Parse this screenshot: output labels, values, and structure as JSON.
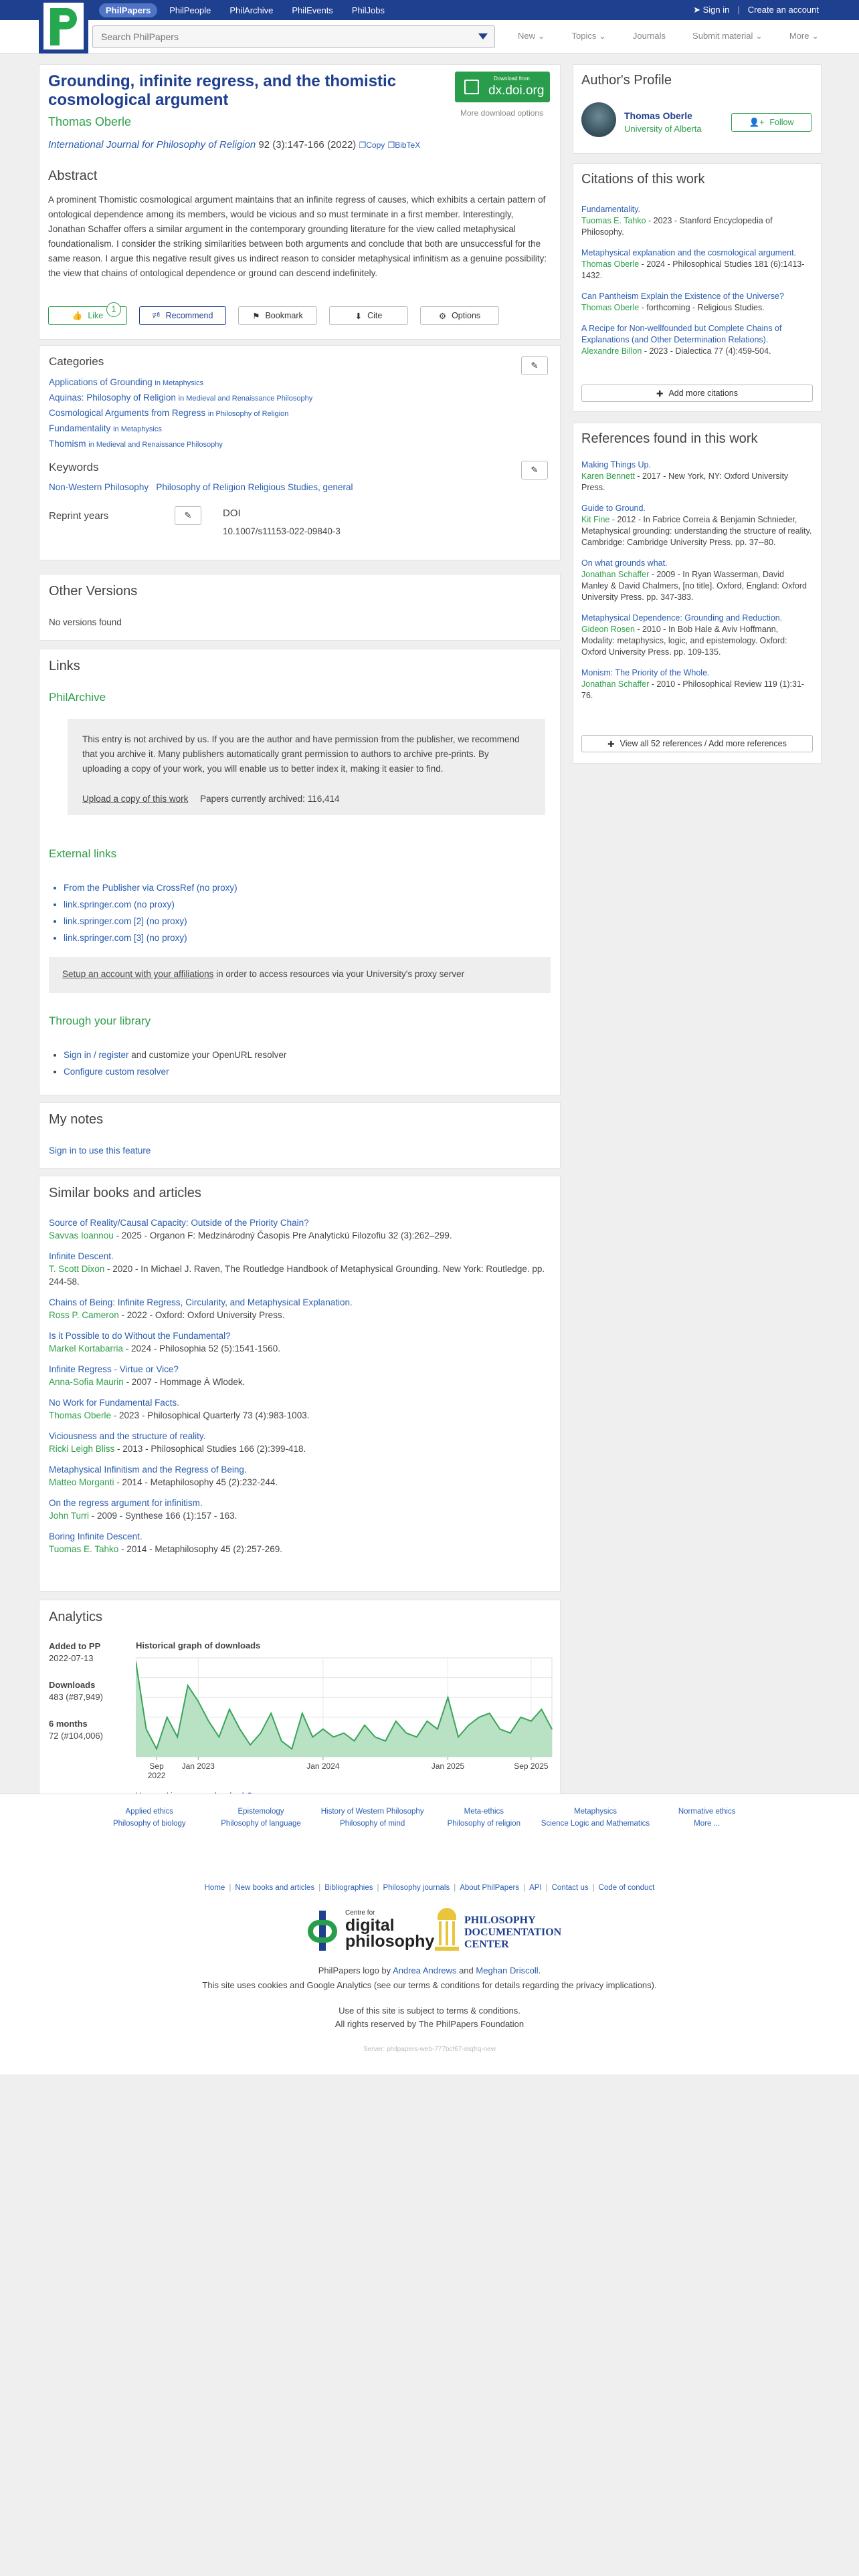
{
  "topnav": {
    "items": [
      "PhilPapers",
      "PhilPeople",
      "PhilArchive",
      "PhilEvents",
      "PhilJobs"
    ],
    "signin": "Sign in",
    "create": "Create an account"
  },
  "search": {
    "placeholder": "Search PhilPapers"
  },
  "subnav": [
    "New",
    "Topics",
    "Journals",
    "Submit material",
    "More"
  ],
  "paper": {
    "title": "Grounding, infinite regress, and the thomistic cosmological argument",
    "author": "Thomas Oberle",
    "journal": "International Journal for Philosophy of Religion",
    "citation": "92 (3):147-166 (2022)",
    "copy": "Copy",
    "bibtex": "BibTeX",
    "download_small": "Download from",
    "download_big": "dx.doi.org",
    "more_options": "More download options",
    "abstract_title": "Abstract",
    "abstract": "A prominent Thomistic cosmological argument maintains that an infinite regress of causes, which exhibits a certain pattern of ontological dependence among its members, would be vicious and so must terminate in a first member. Interestingly, Jonathan Schaffer offers a similar argument in the contemporary grounding literature for the view called metaphysical foundationalism. I consider the striking similarities between both arguments and conclude that both are unsuccessful for the same reason. I argue this negative result gives us indirect reason to consider metaphysical infinitism as a genuine possibility: the view that chains of ontological dependence or ground can descend indefinitely.",
    "buttons": {
      "like": "Like",
      "like_count": "1",
      "recommend": "Recommend",
      "bookmark": "Bookmark",
      "cite": "Cite",
      "options": "Options"
    }
  },
  "categories": {
    "title": "Categories",
    "items": [
      {
        "name": "Applications of Grounding",
        "in": "in Metaphysics"
      },
      {
        "name": "Aquinas: Philosophy of Religion",
        "in": "in Medieval and Renaissance Philosophy"
      },
      {
        "name": "Cosmological Arguments from Regress",
        "in": "in Philosophy of Religion"
      },
      {
        "name": "Fundamentality",
        "in": "in Metaphysics"
      },
      {
        "name": "Thomism",
        "in": "in Medieval and Renaissance Philosophy"
      }
    ],
    "keywords_title": "Keywords",
    "keywords": [
      "Non-Western Philosophy",
      "Philosophy of Religion  Religious Studies, general"
    ],
    "reprint_title": "Reprint years",
    "doi_title": "DOI",
    "doi": "10.1007/s11153-022-09840-3"
  },
  "other_versions": {
    "title": "Other Versions",
    "text": "No versions found"
  },
  "links": {
    "title": "Links",
    "philarchive": "PhilArchive",
    "archive_note": "This entry is not archived by us. If you are the author and have permission from the publisher, we recommend that you archive it. Many publishers automatically grant permission to authors to archive pre-prints. By uploading a copy of your work, you will enable us to better index it, making it easier to find.",
    "upload": "Upload a copy of this work",
    "archived_count": "Papers currently archived: 116,414",
    "external_title": "External links",
    "external": [
      "From the Publisher via CrossRef (no proxy)",
      "link.springer.com (no proxy)",
      "link.springer.com [2] (no proxy)",
      "link.springer.com [3] (no proxy)"
    ],
    "proxy_link": "Setup an account with your affiliations",
    "proxy_text": " in order to access resources via your University's proxy server",
    "library_title": "Through your library",
    "lib_signin": "Sign in / register",
    "lib_text": " and customize your OpenURL resolver",
    "lib_custom": "Configure custom resolver"
  },
  "notes": {
    "title": "My notes",
    "signin": "Sign in to use this feature"
  },
  "similar": {
    "title": "Similar books and articles",
    "items": [
      {
        "t": "Source of Reality/Causal Capacity: Outside of the Priority Chain?",
        "a": "Savvas Ioannou",
        "rest": " - 2025 - Organon F: Medzinárodný Časopis Pre Analytickú Filozofiu 32 (3):262–299."
      },
      {
        "t": "Infinite Descent.",
        "a": "T. Scott Dixon",
        "rest": " - 2020 - In Michael J. Raven, The Routledge Handbook of Metaphysical Grounding. New York: Routledge. pp. 244-58."
      },
      {
        "t": "Chains of Being: Infinite Regress, Circularity, and Metaphysical Explanation.",
        "a": "Ross P. Cameron",
        "rest": " - 2022 - Oxford: Oxford University Press."
      },
      {
        "t": "Is it Possible to do Without the Fundamental?",
        "a": "Markel Kortabarria",
        "rest": " - 2024 - Philosophia 52 (5):1541-1560."
      },
      {
        "t": "Infinite Regress - Virtue or Vice?",
        "a": "Anna-Sofia Maurin",
        "rest": " - 2007 - Hommage À Wlodek."
      },
      {
        "t": "No Work for Fundamental Facts.",
        "a": "Thomas Oberle",
        "rest": " - 2023 - Philosophical Quarterly 73 (4):983-1003."
      },
      {
        "t": "Viciousness and the structure of reality.",
        "a": "Ricki Leigh Bliss",
        "rest": " - 2013 - Philosophical Studies 166 (2):399-418."
      },
      {
        "t": "Metaphysical Infinitism and the Regress of Being.",
        "a": "Matteo Morganti",
        "rest": " - 2014 - Metaphilosophy 45 (2):232-244."
      },
      {
        "t": "On the regress argument for infinitism.",
        "a": "John Turri",
        "rest": " - 2009 - Synthese 166 (1):157 - 163."
      },
      {
        "t": "Boring Infinite Descent.",
        "a": "Tuomas E. Tahko",
        "rest": " - 2014 - Metaphilosophy 45 (2):257-269."
      }
    ]
  },
  "analytics": {
    "title": "Analytics",
    "added_label": "Added to PP",
    "added": "2022-07-13",
    "downloads_label": "Downloads",
    "downloads": "483 (#87,949)",
    "six_label": "6 months",
    "six": "72 (#104,006)",
    "graph_title": "Historical graph of downloads",
    "increase": "How can I increase my downloads?",
    "x_ticks": [
      "Sep 2022",
      "Jan 2023",
      "Jan 2024",
      "Jan 2025",
      "Sep 2025"
    ]
  },
  "chart_data": {
    "type": "area",
    "title": "Historical graph of downloads",
    "x": [
      "Jul 2022",
      "Aug 2022",
      "Sep 2022",
      "Oct 2022",
      "Nov 2022",
      "Dec 2022",
      "Jan 2023",
      "Feb 2023",
      "Mar 2023",
      "Apr 2023",
      "May 2023",
      "Jun 2023",
      "Jul 2023",
      "Aug 2023",
      "Sep 2023",
      "Oct 2023",
      "Nov 2023",
      "Dec 2023",
      "Jan 2024",
      "Feb 2024",
      "Mar 2024",
      "Apr 2024",
      "May 2024",
      "Jun 2024",
      "Jul 2024",
      "Aug 2024",
      "Sep 2024",
      "Oct 2024",
      "Nov 2024",
      "Dec 2024",
      "Jan 2025",
      "Feb 2025",
      "Mar 2025",
      "Apr 2025",
      "May 2025",
      "Jun 2025",
      "Jul 2025",
      "Aug 2025",
      "Sep 2025",
      "Oct 2025",
      "Nov 2025"
    ],
    "values": [
      48,
      14,
      4,
      20,
      10,
      36,
      28,
      18,
      10,
      24,
      14,
      6,
      12,
      22,
      8,
      4,
      22,
      10,
      14,
      10,
      12,
      8,
      16,
      10,
      8,
      18,
      12,
      10,
      18,
      14,
      30,
      10,
      16,
      20,
      22,
      14,
      12,
      20,
      18,
      24,
      14
    ],
    "ylim": [
      0,
      50
    ],
    "grid": true,
    "fill_color": "#b9e2c4",
    "line_color": "#3aa35a"
  },
  "profile": {
    "title": "Author's Profile",
    "name": "Thomas Oberle",
    "affil": "University of Alberta",
    "follow": "Follow"
  },
  "citations": {
    "title": "Citations of this work",
    "items": [
      {
        "t": "Fundamentality.",
        "a": "Tuomas E. Tahko",
        "rest": " - 2023 - Stanford Encyclopedia of Philosophy."
      },
      {
        "t": "Metaphysical explanation and the cosmological argument.",
        "a": "Thomas Oberle",
        "rest": " - 2024 - Philosophical Studies 181 (6):1413-1432."
      },
      {
        "t": "Can Pantheism Explain the Existence of the Universe?",
        "a": "Thomas Oberle",
        "rest": " - forthcoming - Religious Studies."
      },
      {
        "t": "A Recipe for Non-wellfounded but Complete Chains of Explanations (and Other Determination Relations).",
        "a": "Alexandre Billon",
        "rest": " - 2023 - Dialectica 77 (4):459-504."
      }
    ],
    "add_more": "Add more citations"
  },
  "references": {
    "title": "References found in this work",
    "items": [
      {
        "t": "Making Things Up.",
        "a": "Karen Bennett",
        "rest": " - 2017 - New York, NY: Oxford University Press."
      },
      {
        "t": "Guide to Ground.",
        "a": "Kit Fine",
        "rest": " - 2012 - In Fabrice Correia & Benjamin Schnieder, Metaphysical grounding: understanding the structure of reality. Cambridge: Cambridge University Press. pp. 37--80."
      },
      {
        "t": "On what grounds what.",
        "a": "Jonathan Schaffer",
        "rest": " - 2009 - In Ryan Wasserman, David Manley & David Chalmers, [no title]. Oxford, England: Oxford University Press. pp. 347-383."
      },
      {
        "t": "Metaphysical Dependence: Grounding and Reduction.",
        "a": "Gideon Rosen",
        "rest": " - 2010 - In Bob Hale & Aviv Hoffmann, Modality: metaphysics, logic, and epistemology. Oxford: Oxford University Press. pp. 109-135."
      },
      {
        "t": "Monism: The Priority of the Whole.",
        "a": "Jonathan Schaffer",
        "rest": " - 2010 - Philosophical Review 119 (1):31-76."
      }
    ],
    "view_all": "View all 52 references / Add more references"
  },
  "footer": {
    "cats": [
      "Applied ethics",
      "Epistemology",
      "History of Western Philosophy",
      "Meta-ethics",
      "Metaphysics",
      "Normative ethics",
      "Philosophy of biology",
      "Philosophy of language",
      "Philosophy of mind",
      "Philosophy of religion",
      "Science Logic and Mathematics",
      "More ..."
    ],
    "links": [
      "Home",
      "New books and articles",
      "Bibliographies",
      "Philosophy journals",
      "About PhilPapers",
      "API",
      "Contact us",
      "Code of conduct"
    ],
    "cdp_small": "Centre for",
    "cdp_big1": "digital",
    "cdp_big2": "philosophy",
    "pdc1": "PHILOSOPHY",
    "pdc2": "DOCUMENTATION",
    "pdc3": "CENTER",
    "logo_credit_a": "PhilPapers logo by ",
    "logo_credit_b": "Andrea Andrews",
    "logo_credit_c": " and ",
    "logo_credit_d": "Meghan Driscoll",
    "logo_credit_e": ".",
    "cookies": "This site uses cookies and Google Analytics (see our terms & conditions for details regarding the privacy implications).",
    "terms": "Use of this site is subject to terms & conditions.",
    "rights": "All rights reserved by The PhilPapers Foundation",
    "server": "Server: philpapers-web-777bcf67-mqfrq-new"
  }
}
